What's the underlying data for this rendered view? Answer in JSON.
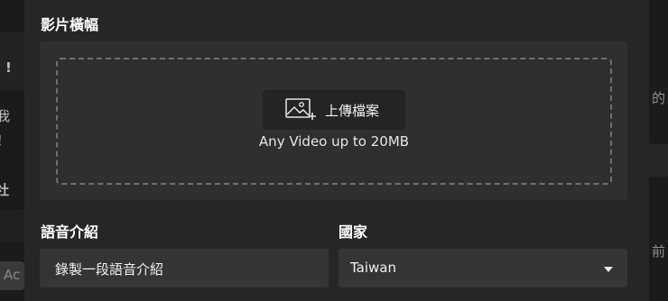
{
  "background": {
    "left_fragments": [
      "!",
      "我",
      "！",
      "社",
      "Ac"
    ],
    "right_fragments": [
      "的",
      "前"
    ]
  },
  "modal": {
    "video_banner": {
      "title": "影片橫幅",
      "upload_button_label": "上傳檔案",
      "upload_hint": "Any Video up to 20MB"
    },
    "voice_intro": {
      "title": "語音介紹",
      "field_value": "錄製一段語音介紹"
    },
    "country": {
      "title": "國家",
      "selected": "Taiwan"
    }
  },
  "colors": {
    "modal_bg": "#262626",
    "upload_area_bg": "#2f2f2f",
    "field_bg": "#353535",
    "dashed_border": "#6f6f6f"
  },
  "icons": [
    "add-image-icon",
    "chevron-down-icon"
  ]
}
